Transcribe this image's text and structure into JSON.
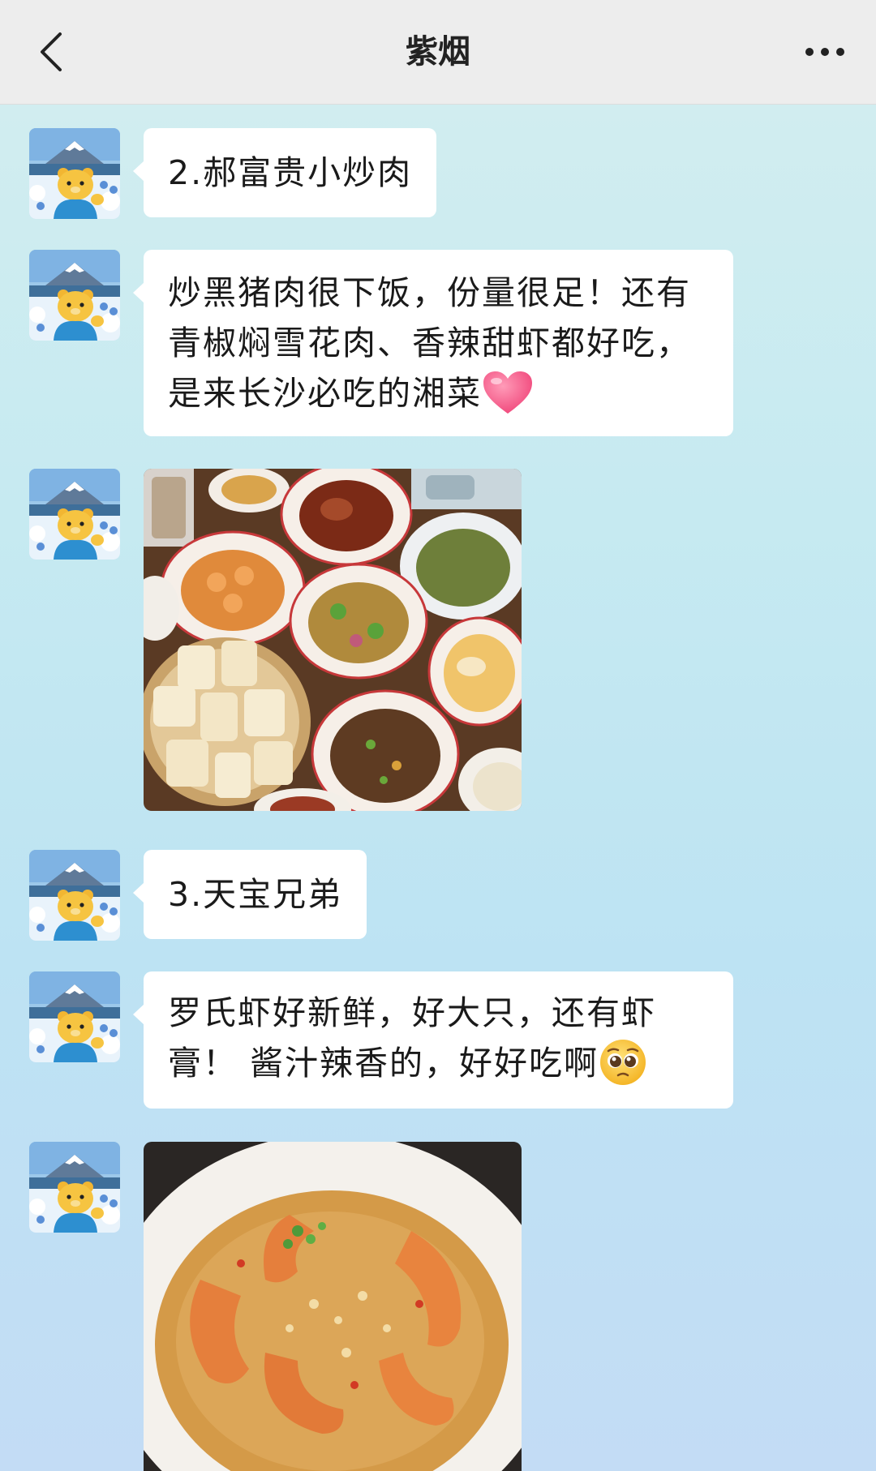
{
  "header": {
    "title": "紫烟"
  },
  "messages": [
    {
      "type": "text",
      "text": "2.郝富贵小炒肉"
    },
    {
      "type": "text",
      "text": "炒黑猪肉很下饭，份量很足！还有青椒焖雪花肉、香辣甜虾都好吃，是来长沙必吃的湘菜",
      "emoji": "pink-heart-icon"
    },
    {
      "type": "image",
      "description": "table-of-hunan-dishes"
    },
    {
      "type": "text",
      "text": "3.天宝兄弟"
    },
    {
      "type": "text",
      "text": "罗氏虾好新鲜，好大只，还有虾膏！ 酱汁辣香的，好好吃啊",
      "emoji": "pleading-face-icon"
    },
    {
      "type": "image",
      "description": "shrimp-in-garlic-sauce"
    }
  ],
  "colors": {
    "navbar_bg": "#ededed",
    "bubble_bg": "#ffffff",
    "chat_bg_top": "#d4eef0",
    "chat_bg_bottom": "#c3dcf5"
  }
}
